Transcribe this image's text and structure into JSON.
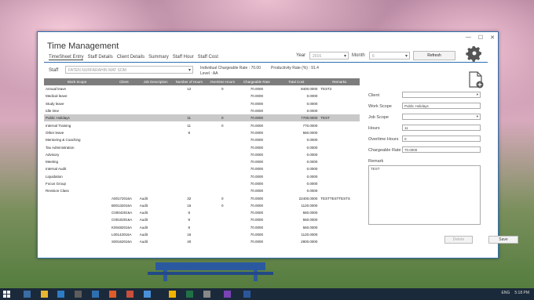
{
  "window": {
    "title": "Time Management"
  },
  "tabs": [
    "TimeSheet Entry",
    "Staff Details",
    "Client Details",
    "Summary",
    "Staff Hour",
    "Staff Cost"
  ],
  "filters": {
    "year_label": "Year",
    "year_value": "2016",
    "month_label": "Month",
    "month_value": "6",
    "refresh_label": "Refresh",
    "staff_label": "Staff",
    "staff_value": "FATEN NURFARAHIN MAT SOM",
    "chargeable_rate": "Individual Chargeable Rate : 70.00",
    "level": "Level : AA",
    "productivity_rate": "Productivity Rate (%) : 91.4"
  },
  "grid": {
    "columns": [
      "Work Scope",
      "Client",
      "Job Description",
      "Number of Hours",
      "Overtime Hours",
      "Chargeable Rate",
      "Total Cost",
      "Remarks"
    ],
    "rows": [
      [
        "Annual leave",
        "",
        "",
        "12",
        "0",
        "70.0000",
        "8400.0000",
        "TEST2"
      ],
      [
        "Medical leave",
        "",
        "",
        "",
        "",
        "70.0000",
        "0.0000",
        ""
      ],
      [
        "Study leave",
        "",
        "",
        "",
        "",
        "70.0000",
        "0.0000",
        ""
      ],
      [
        "Idle time",
        "",
        "",
        "",
        "",
        "70.0000",
        "0.0000",
        ""
      ],
      [
        "Public Holidays",
        "",
        "",
        "11",
        "0",
        "70.0000",
        "7700.0000",
        "TEST"
      ],
      [
        "Internal Training",
        "",
        "",
        "11",
        "0",
        "70.0000",
        "770.0000",
        ""
      ],
      [
        "Other leave",
        "",
        "",
        "8",
        "",
        "70.0000",
        "560.0000",
        ""
      ],
      [
        "Mentoring & Coaching",
        "",
        "",
        "",
        "",
        "70.0000",
        "0.0000",
        ""
      ],
      [
        "Tax Administration",
        "",
        "",
        "",
        "",
        "70.0000",
        "0.0000",
        ""
      ],
      [
        "Advisory",
        "",
        "",
        "",
        "",
        "70.0000",
        "0.0000",
        ""
      ],
      [
        "Meeting",
        "",
        "",
        "",
        "",
        "70.0000",
        "0.0000",
        ""
      ],
      [
        "Internal Audit",
        "",
        "",
        "",
        "",
        "70.0000",
        "0.0000",
        ""
      ],
      [
        "Liquidation",
        "",
        "",
        "",
        "",
        "70.0000",
        "0.0000",
        ""
      ],
      [
        "Focus Group",
        "",
        "",
        "",
        "",
        "70.0000",
        "0.0000",
        ""
      ],
      [
        "Revision Class",
        "",
        "",
        "",
        "",
        "70.0000",
        "0.0000",
        ""
      ],
      [
        "",
        "A00172016A",
        "Audit",
        "32",
        "0",
        "70.0000",
        "22400.0000",
        "TESTTESTTESTS"
      ],
      [
        "",
        "B00132016A",
        "Audit",
        "16",
        "0",
        "70.0000",
        "1120.0000",
        ""
      ],
      [
        "",
        "C00042016A",
        "Audit",
        "8",
        "",
        "70.0000",
        "560.0000",
        ""
      ],
      [
        "",
        "C00102016A",
        "Audit",
        "8",
        "",
        "70.0000",
        "560.0000",
        ""
      ],
      [
        "",
        "K00482016A",
        "Audit",
        "8",
        "",
        "70.0000",
        "560.0000",
        ""
      ],
      [
        "",
        "L00142016A",
        "Audit",
        "16",
        "",
        "70.0000",
        "1120.0000",
        ""
      ],
      [
        "",
        "S00162016A",
        "Audit",
        "40",
        "",
        "70.0000",
        "2800.0000",
        ""
      ]
    ],
    "selected_row": 4
  },
  "form": {
    "client_label": "Client",
    "client_value": "",
    "work_scope_label": "Work Scope",
    "work_scope_value": "Public Holidays",
    "job_scope_label": "Job Scope",
    "job_scope_value": "",
    "hours_label": "Hours",
    "hours_value": "11",
    "overtime_label": "Overtime Hours",
    "overtime_value": "0",
    "chargeable_label": "Chargeable Rate",
    "chargeable_value": "70.0000",
    "remark_label": "Remark",
    "remark_value": "TEST",
    "delete_label": "Delete",
    "save_label": "Save"
  },
  "taskbar": {
    "lang": "ENG",
    "time": "5:18 PM"
  },
  "colors": {
    "accent": "#2f6fb0",
    "header": "#7d7d7d",
    "selected": "#c9c9c9"
  }
}
